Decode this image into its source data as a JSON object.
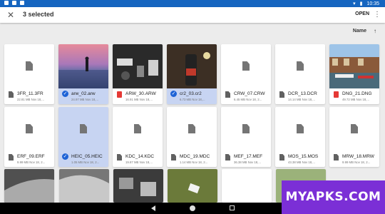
{
  "status_bar": {
    "time": "10:35"
  },
  "app_bar": {
    "title": "3 selected",
    "open_label": "OPEN"
  },
  "sort": {
    "label": "Name"
  },
  "files": [
    {
      "name": "3FR_11.3FR",
      "meta": "22.81 MB Nov 18,...",
      "selected": false,
      "thumb": "doc",
      "type_icon": "doc"
    },
    {
      "name": "arw_02.arw",
      "meta": "24.97 MB Nov 18,...",
      "selected": true,
      "thumb": "photo-sunset-figure",
      "type_icon": "check"
    },
    {
      "name": "ARW_30.ARW",
      "meta": "16.91 MB Nov 18,...",
      "selected": false,
      "thumb": "photo-electronics",
      "type_icon": "image"
    },
    {
      "name": "cr2_03.cr2",
      "meta": "6.73 MB Nov 18,...",
      "selected": true,
      "thumb": "photo-bottle",
      "type_icon": "check"
    },
    {
      "name": "CRW_07.CRW",
      "meta": "6.45 MB Nov 18, 2...",
      "selected": false,
      "thumb": "doc",
      "type_icon": "doc"
    },
    {
      "name": "DCR_13.DCR",
      "meta": "14.14 MB Nov 18,...",
      "selected": false,
      "thumb": "doc",
      "type_icon": "doc"
    },
    {
      "name": "DNG_21.DNG",
      "meta": "49.72 MB Nov 18,...",
      "selected": false,
      "thumb": "photo-canal",
      "type_icon": "image"
    },
    {
      "name": "ERF_09.ERF",
      "meta": "9.99 MB Nov 18, 2...",
      "selected": false,
      "thumb": "doc",
      "type_icon": "doc"
    },
    {
      "name": "HEIC_05.HEIC",
      "meta": "1.05 MB Nov 18, 2...",
      "selected": true,
      "thumb": "doc",
      "type_icon": "check"
    },
    {
      "name": "KDC_14.KDC",
      "meta": "19.87 MB Nov 18,...",
      "selected": false,
      "thumb": "doc",
      "type_icon": "doc"
    },
    {
      "name": "MDC_19.MDC",
      "meta": "1.14 MB Nov 18, 2...",
      "selected": false,
      "thumb": "doc",
      "type_icon": "doc"
    },
    {
      "name": "MEF_17.MEF",
      "meta": "36.38 MB Nov 18,...",
      "selected": false,
      "thumb": "doc",
      "type_icon": "doc"
    },
    {
      "name": "MOS_15.MOS",
      "meta": "43.38 MB Nov 18,...",
      "selected": false,
      "thumb": "doc",
      "type_icon": "doc"
    },
    {
      "name": "MRW_18.MRW",
      "meta": "9.99 MB Nov 18, 2...",
      "selected": false,
      "thumb": "doc",
      "type_icon": "doc"
    }
  ],
  "watermark": "MYAPKS.COM",
  "colors": {
    "status_bar": "#1565c0",
    "selected_card": "#c7d4f2",
    "check": "#1e63d6",
    "watermark": "#7b2fd6"
  }
}
